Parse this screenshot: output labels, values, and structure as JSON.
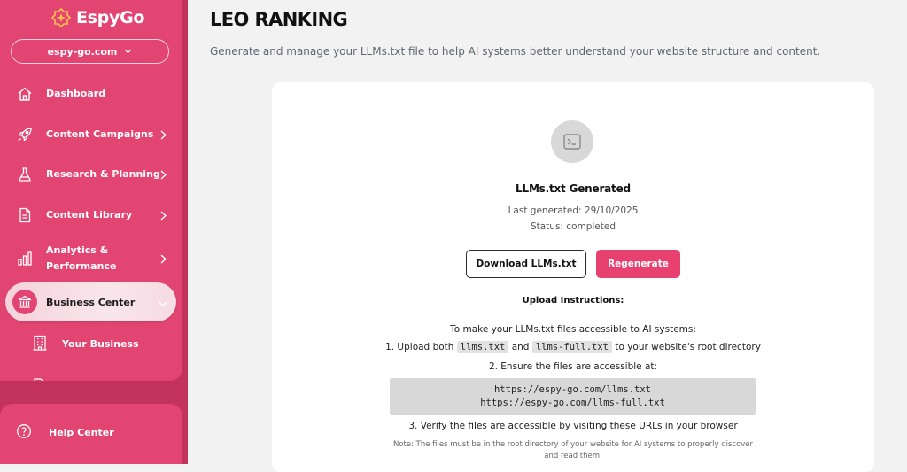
{
  "app": {
    "name": "EspyGo"
  },
  "domain_selector": {
    "value": "espy-go.com"
  },
  "sidebar": {
    "items": [
      {
        "label": "Dashboard"
      },
      {
        "label": "Content Campaigns"
      },
      {
        "label": "Research & Planning"
      },
      {
        "label": "Content Library"
      },
      {
        "label_line1": "Analytics &",
        "label_line2": "Performance"
      }
    ],
    "active": {
      "label": "Business Center"
    },
    "sub_items": [
      {
        "label": "Your Business"
      }
    ],
    "help": {
      "label": "Help Center"
    }
  },
  "header": {
    "title": "LEO RANKING",
    "description": "Generate and manage your LLMs.txt file to help AI systems better understand your website structure and content."
  },
  "card": {
    "title": "LLMs.txt Generated",
    "last_generated": "Last generated: 29/10/2025",
    "status": "Status: completed",
    "download_label": "Download LLMs.txt",
    "regenerate_label": "Regenerate",
    "upload_title": "Upload Instructions:",
    "intro": "To make your LLMs.txt files accessible to AI systems:",
    "step1_prefix": "1. Upload both",
    "step1_file1": "llms.txt",
    "step1_and": "and",
    "step1_file2": "llms-full.txt",
    "step1_suffix": "to your website's root directory",
    "step2": "2. Ensure the files are accessible at:",
    "url1": "https://espy-go.com/llms.txt",
    "url2": "https://espy-go.com/llms-full.txt",
    "step3": "3. Verify the files are accessible by visiting these URLs in your browser",
    "note_line1": "Note: The files must be in the root directory of your website for AI systems to properly discover",
    "note_line2": "and read them."
  },
  "colors": {
    "brand": "#e34573",
    "sidebar_dark": "#c2325d",
    "accent_button": "#e8416f"
  }
}
